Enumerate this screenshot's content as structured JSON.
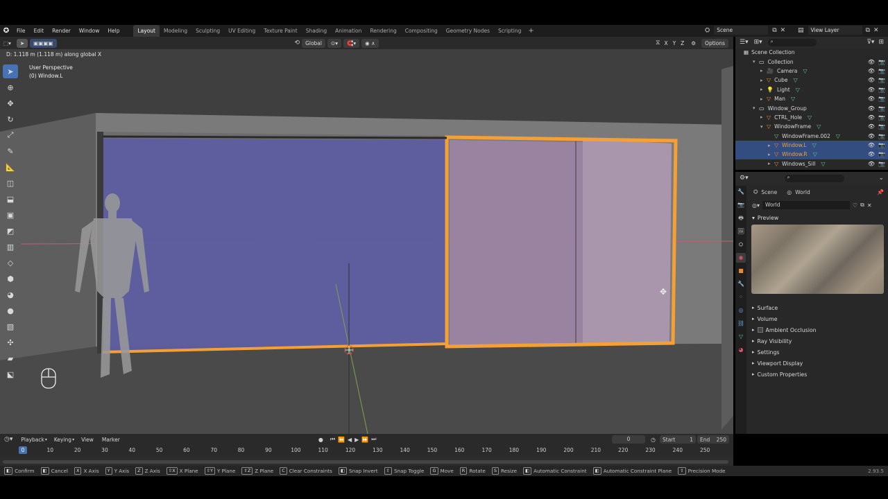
{
  "menu": {
    "items": [
      "File",
      "Edit",
      "Render",
      "Window",
      "Help"
    ],
    "workspaces": [
      "Layout",
      "Modeling",
      "Sculpting",
      "UV Editing",
      "Texture Paint",
      "Shading",
      "Animation",
      "Rendering",
      "Compositing",
      "Geometry Nodes",
      "Scripting"
    ],
    "active_workspace": "Layout",
    "add_tab": "+",
    "scene": "Scene",
    "view_layer": "View Layer"
  },
  "viewport": {
    "status_line": "D: 1.118 m (1.118 m) along global X",
    "perspective": "User Perspective",
    "active_object": "(0) Window.L",
    "orientation": "Global",
    "axes": [
      "X",
      "Y",
      "Z"
    ],
    "options": "Options"
  },
  "outliner": {
    "root": "Scene Collection",
    "rows": [
      {
        "label": "Collection",
        "depth": 1,
        "icon": "collection-icon"
      },
      {
        "label": "Camera",
        "depth": 2,
        "icon": "camera-icon"
      },
      {
        "label": "Cube",
        "depth": 2,
        "icon": "mesh-icon"
      },
      {
        "label": "Light",
        "depth": 2,
        "icon": "light-icon"
      },
      {
        "label": "Man",
        "depth": 2,
        "icon": "mesh-icon"
      },
      {
        "label": "Window_Group",
        "depth": 1,
        "icon": "collection-icon"
      },
      {
        "label": "CTRL_Hole",
        "depth": 2,
        "icon": "mesh-icon"
      },
      {
        "label": "WindowFrame",
        "depth": 2,
        "icon": "mesh-icon"
      },
      {
        "label": "WindowFrame.002",
        "depth": 3,
        "icon": "mesh-data-icon"
      },
      {
        "label": "Window.L",
        "depth": 3,
        "icon": "mesh-icon",
        "selected": true
      },
      {
        "label": "Window.R",
        "depth": 3,
        "icon": "mesh-icon",
        "selected": true
      },
      {
        "label": "Windows_Sill",
        "depth": 3,
        "icon": "mesh-icon"
      }
    ]
  },
  "properties": {
    "breadcrumb_scene": "Scene",
    "breadcrumb_world": "World",
    "world_name": "World",
    "preview_label": "Preview",
    "sections": [
      "Surface",
      "Volume",
      "Ambient Occlusion",
      "Ray Visibility",
      "Settings",
      "Viewport Display",
      "Custom Properties"
    ]
  },
  "timeline": {
    "menus": [
      "Playback",
      "Keying",
      "View",
      "Marker"
    ],
    "current_frame": "0",
    "start_label": "Start",
    "start": "1",
    "end_label": "End",
    "end": "250",
    "ticks": [
      "0",
      "10",
      "20",
      "30",
      "40",
      "50",
      "60",
      "70",
      "80",
      "90",
      "100",
      "110",
      "120",
      "130",
      "140",
      "150",
      "160",
      "170",
      "180",
      "190",
      "200",
      "210",
      "220",
      "230",
      "240",
      "250"
    ]
  },
  "statusbar": {
    "items": [
      {
        "key": "",
        "label": "Confirm"
      },
      {
        "key": "",
        "label": "Cancel"
      },
      {
        "key": "X",
        "label": "X Axis"
      },
      {
        "key": "Y",
        "label": "Y Axis"
      },
      {
        "key": "Z",
        "label": "Z Axis"
      },
      {
        "key": "⇧X",
        "label": "X Plane"
      },
      {
        "key": "⇧Y",
        "label": "Y Plane"
      },
      {
        "key": "⇧Z",
        "label": "Z Plane"
      },
      {
        "key": "C",
        "label": "Clear Constraints"
      },
      {
        "key": "",
        "label": "Snap Invert"
      },
      {
        "key": "⇧",
        "label": "Snap Toggle"
      },
      {
        "key": "G",
        "label": "Move"
      },
      {
        "key": "R",
        "label": "Rotate"
      },
      {
        "key": "S",
        "label": "Resize"
      },
      {
        "key": "",
        "label": "Automatic Constraint"
      },
      {
        "key": "",
        "label": "Automatic Constraint Plane"
      },
      {
        "key": "⇧",
        "label": "Precision Mode"
      }
    ],
    "version": "2.93.5"
  },
  "colors": {
    "selection_orange": "#f5a035",
    "glass_blue": "#6a6aa8",
    "glass_pink": "#a48aa6",
    "accent_blue": "#4772b3"
  }
}
